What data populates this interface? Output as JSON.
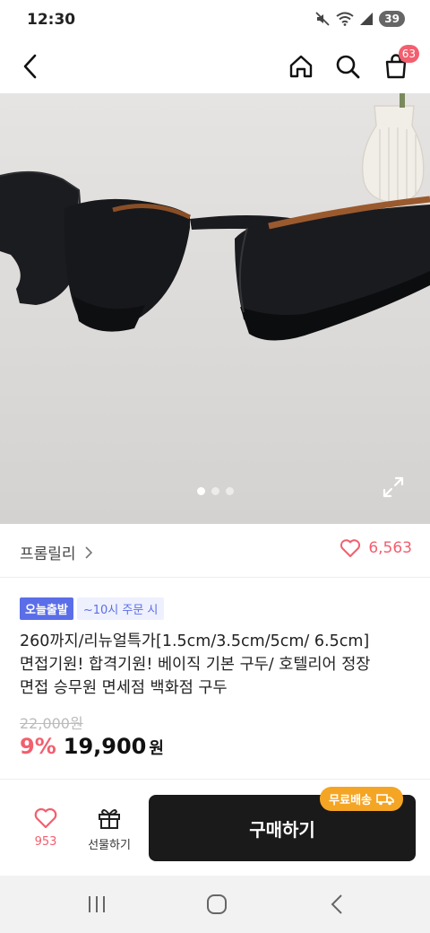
{
  "status": {
    "time": "12:30",
    "battery": "39"
  },
  "header": {
    "cart_count": "63"
  },
  "gallery": {
    "active_index": 0,
    "total": 3
  },
  "seller": {
    "name": "프롬릴리",
    "like_count": "6,563"
  },
  "product": {
    "badge_today": "오늘출발",
    "badge_order": "~10시 주문 시",
    "title_lines": [
      "260까지/리뉴얼특가[1.5cm/3.5cm/5cm/ 6.5cm]",
      "면접기원! 합격기원! 베이직 기본 구두/ 호텔리어 정장",
      "면접 승무원 면세점 백화점 구두"
    ],
    "original_price": "22,000원",
    "discount": "9%",
    "price": "19,900",
    "currency": "원"
  },
  "bottom": {
    "wish_count": "953",
    "gift_label": "선물하기",
    "buy_label": "구매하기",
    "free_shipping": "무료배송"
  },
  "colors": {
    "accent": "#f25f6e",
    "badge_blue": "#5b6ee8",
    "shipping": "#f5a524",
    "buy_button": "#1a1a1a"
  }
}
